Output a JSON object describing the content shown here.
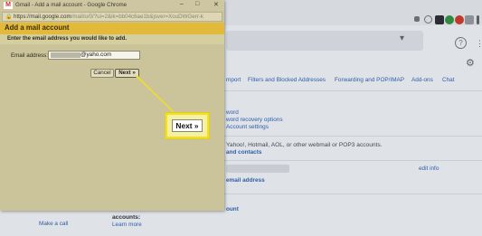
{
  "popup": {
    "window_title": "Gmail - Add a mail account - Google Chrome",
    "url": "https://mail.google.com/mail/u/0/?ui=2&ik=bb04c6ae1b&jsver=XouDWGerr-k",
    "url_host": "https://mail.google.com",
    "url_rest": "/mail/u/0/?ui=2&ik=bb04c6ae1b&jsver=XouDWGerr-k",
    "header_title": "Add a mail account",
    "instruction": "Enter the email address you would like to add.",
    "email_label": "Email address:",
    "email_value": "@yaho.com",
    "cancel_label": "Cancel",
    "next_label": "Next »",
    "window_controls": [
      "–",
      "□",
      "✕"
    ]
  },
  "callout": {
    "label": "Next »",
    "highlight_color": "#f2e021"
  },
  "gmail_settings": {
    "tabs": [
      "mport",
      "Filters and Blocked Addresses",
      "Forwarding and POP/IMAP",
      "Add-ons",
      "Chat"
    ],
    "links": [
      "word",
      "word recovery options",
      "Account settings"
    ],
    "import_text": "Yahoo!, Hotmail, AOL, or other webmail or POP3 accounts.",
    "import_link": "and contacts",
    "edit_info": "edit info",
    "email_address_link": "email address",
    "account_link": "ount",
    "make_a_call": "Make a call",
    "accounts_label": "accounts:",
    "learn_more": "Learn more"
  },
  "colors": {
    "header": "#e3b93a",
    "link": "#2e5ea8",
    "overlay": "#c9c29b"
  }
}
